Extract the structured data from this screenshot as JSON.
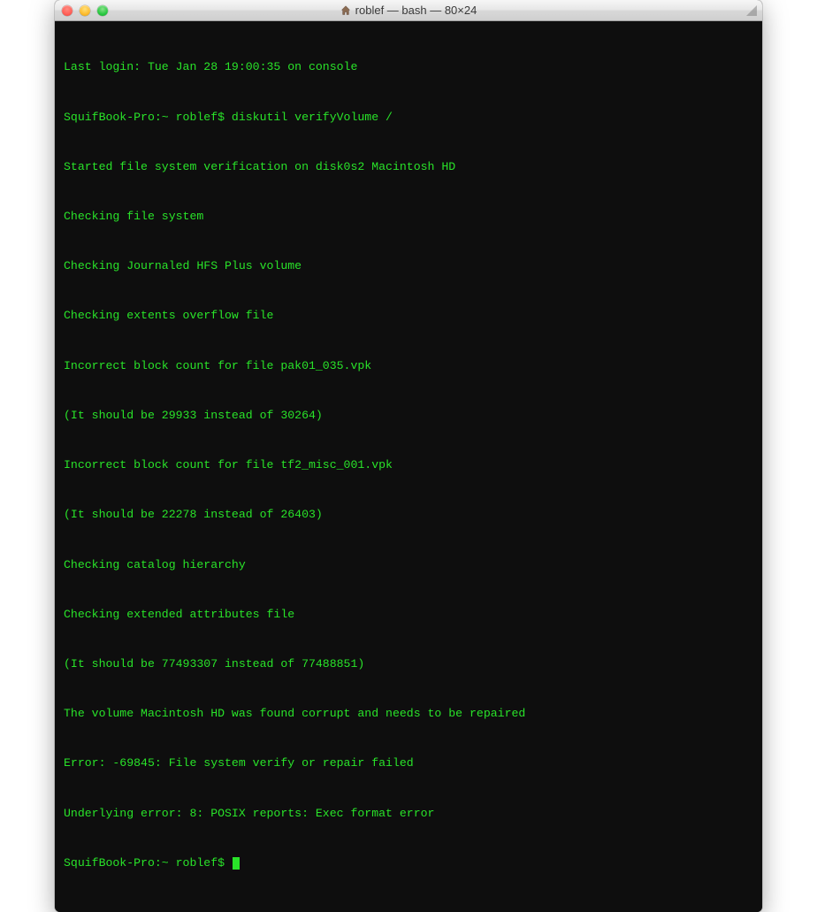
{
  "titlebar": {
    "title": "roblef — bash — 80×24",
    "home_icon": "home-icon"
  },
  "terminal": {
    "lines": [
      "Last login: Tue Jan 28 19:00:35 on console",
      "SquifBook-Pro:~ roblef$ diskutil verifyVolume /",
      "Started file system verification on disk0s2 Macintosh HD",
      "Checking file system",
      "Checking Journaled HFS Plus volume",
      "Checking extents overflow file",
      "Incorrect block count for file pak01_035.vpk",
      "(It should be 29933 instead of 30264)",
      "Incorrect block count for file tf2_misc_001.vpk",
      "(It should be 22278 instead of 26403)",
      "Checking catalog hierarchy",
      "Checking extended attributes file",
      "(It should be 77493307 instead of 77488851)",
      "The volume Macintosh HD was found corrupt and needs to be repaired",
      "Error: -69845: File system verify or repair failed",
      "Underlying error: 8: POSIX reports: Exec format error"
    ],
    "prompt": "SquifBook-Pro:~ roblef$ "
  }
}
